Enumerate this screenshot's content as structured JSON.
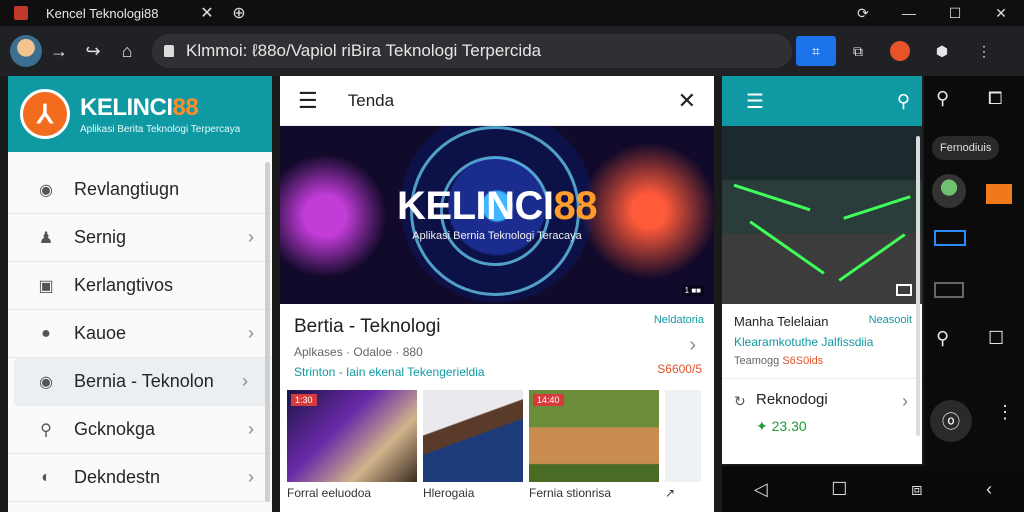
{
  "browser": {
    "tab_title": "Kencel Teknologi88",
    "tab_close": "✕",
    "tab_new": "⊕",
    "url": "Klmmoi: ℓ88o/Vapiol riBira Teknologi Terpercida",
    "window_controls": [
      "⟳",
      "—",
      "☐",
      "✕"
    ],
    "nav": {
      "back": "→",
      "forward": "↪",
      "home": "⌂"
    },
    "extensions": [
      "⌗",
      "⧉",
      "",
      "⬢",
      "⋮"
    ]
  },
  "sidebar": {
    "brand": "KELINCI88",
    "brand_main": "KELINCI",
    "brand_num": "88",
    "logo_letter": "⅄",
    "tagline": "Aplikasi Berita Teknologi Terpercaya",
    "items": [
      {
        "label": "Revlangtiugn",
        "icon": "camera-icon",
        "glyph": "◉",
        "chevron": ""
      },
      {
        "label": "Sernig",
        "icon": "person-icon",
        "glyph": "♟",
        "chevron": "›"
      },
      {
        "label": "Kerlangtivos",
        "icon": "box-icon",
        "glyph": "▣",
        "chevron": ""
      },
      {
        "label": "Kauoe",
        "icon": "user-icon",
        "glyph": "●",
        "chevron": "›"
      },
      {
        "label": "Bernia - Teknolon",
        "icon": "camera-icon",
        "glyph": "◉",
        "chevron": "›",
        "active": true
      },
      {
        "label": "Gcknokga",
        "icon": "search-icon",
        "glyph": "⚲",
        "chevron": "›"
      },
      {
        "label": "Dekndestn",
        "icon": "compass-icon",
        "glyph": "◐",
        "chevron": "›"
      }
    ]
  },
  "middle": {
    "menu_glyph": "☰",
    "close_glyph": "✕",
    "title": "Tenda",
    "hero_main": "KELINCI",
    "hero_num": "88",
    "hero_tag": "Aplikasi Bernia Teknologi Teracaya",
    "hero_badge": "1 ■■",
    "article": {
      "title": "Bertia - Teknologi",
      "category": "Neldatoria",
      "meta": "Aplkases · Odaloe · 880",
      "status": "Strinton - Iain ekenal Tekengerieldia",
      "price": "S6600/5",
      "chevron": "›"
    },
    "thumbs": [
      {
        "badge": "1:30",
        "caption": "Forral eeluodoa"
      },
      {
        "badge": "",
        "caption": "Hlerogaia"
      },
      {
        "badge": "14:40",
        "caption": "Fernia stionrisa"
      },
      {
        "badge": "",
        "caption": "↗"
      }
    ]
  },
  "app": {
    "menu_glyph": "☰",
    "search_glyph": "⚲",
    "article": {
      "title": "Manha Telelaian",
      "category": "Neasooit",
      "status": "Klearamkotuthe Jalfissdiia",
      "meta": "Teamogg",
      "price": "S6S0ids"
    },
    "card": {
      "title": "Reknodogi",
      "price": "✦ 23.30",
      "icon_glyph": "↻",
      "chevron": "›"
    },
    "navbar": [
      "◁",
      "☐",
      "⧈",
      "‹"
    ]
  },
  "strip": {
    "pill": "Fernodiuis",
    "glyphs": {
      "search": "⚲",
      "screen": "⧠",
      "find": "⚲",
      "window": "☐",
      "avatar": "ⓞ",
      "more": "⋮"
    }
  },
  "colors": {
    "teal": "#0f9aa3",
    "orange": "#f36b1c",
    "price_red": "#e0532b",
    "price_green": "#1f9b3a",
    "chrome_dark": "#202124"
  }
}
